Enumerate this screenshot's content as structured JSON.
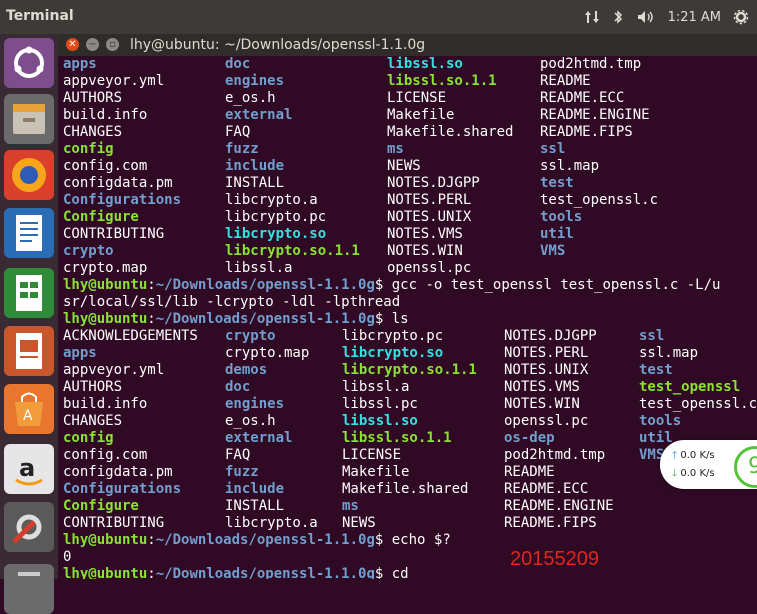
{
  "topbar": {
    "app_name": "Terminal",
    "time": "1:21 AM",
    "icons": [
      "network-updown-icon",
      "bluetooth-icon",
      "volume-icon",
      "settings-gear-icon"
    ]
  },
  "window": {
    "title": "lhy@ubuntu: ~/Downloads/openssl-1.1.0g"
  },
  "launcher": [
    "ubuntu-dash-icon",
    "files-icon",
    "firefox-icon",
    "libreoffice-writer-icon",
    "libreoffice-calc-icon",
    "libreoffice-impress-icon",
    "software-center-icon",
    "amazon-icon",
    "system-settings-icon",
    "trash-icon"
  ],
  "terminal": {
    "prompt_user": "lhy@ubuntu",
    "prompt_path": "~/Downloads/openssl-1.1.0g",
    "listing1": [
      [
        "apps",
        "doc",
        "libssl.so",
        "pod2htmd.tmp"
      ],
      [
        "appveyor.yml",
        "engines",
        "libssl.so.1.1",
        "README"
      ],
      [
        "AUTHORS",
        "e_os.h",
        "LICENSE",
        "README.ECC"
      ],
      [
        "build.info",
        "external",
        "Makefile",
        "README.ENGINE"
      ],
      [
        "CHANGES",
        "FAQ",
        "Makefile.shared",
        "README.FIPS"
      ],
      [
        "config",
        "fuzz",
        "ms",
        "ssl"
      ],
      [
        "config.com",
        "include",
        "NEWS",
        "ssl.map"
      ],
      [
        "configdata.pm",
        "INSTALL",
        "NOTES.DJGPP",
        "test"
      ],
      [
        "Configurations",
        "libcrypto.a",
        "NOTES.PERL",
        "test_openssl.c"
      ],
      [
        "Configure",
        "libcrypto.pc",
        "NOTES.UNIX",
        "tools"
      ],
      [
        "CONTRIBUTING",
        "libcrypto.so",
        "NOTES.VMS",
        "util"
      ],
      [
        "crypto",
        "libcrypto.so.1.1",
        "NOTES.WIN",
        "VMS"
      ],
      [
        "crypto.map",
        "libssl.a",
        "openssl.pc",
        ""
      ]
    ],
    "cmd_gcc": "$ gcc -o test_openssl test_openssl.c -L/u",
    "cmd_gcc_cont": "sr/local/ssl/lib -lcrypto -ldl -lpthread",
    "cmd_ls": "$ ls",
    "listing2": [
      [
        "ACKNOWLEDGEMENTS",
        "crypto",
        "libcrypto.pc",
        "NOTES.DJGPP",
        "ssl"
      ],
      [
        "apps",
        "crypto.map",
        "libcrypto.so",
        "NOTES.PERL",
        "ssl.map"
      ],
      [
        "appveyor.yml",
        "demos",
        "libcrypto.so.1.1",
        "NOTES.UNIX",
        "test"
      ],
      [
        "AUTHORS",
        "doc",
        "libssl.a",
        "NOTES.VMS",
        "test_openssl"
      ],
      [
        "build.info",
        "engines",
        "libssl.pc",
        "NOTES.WIN",
        "test_openssl.c"
      ],
      [
        "CHANGES",
        "e_os.h",
        "libssl.so",
        "openssl.pc",
        "tools"
      ],
      [
        "config",
        "external",
        "libssl.so.1.1",
        "os-dep",
        "util"
      ],
      [
        "config.com",
        "FAQ",
        "LICENSE",
        "pod2htmd.tmp",
        "VMS"
      ],
      [
        "configdata.pm",
        "fuzz",
        "Makefile",
        "README",
        ""
      ],
      [
        "Configurations",
        "include",
        "Makefile.shared",
        "README.ECC",
        ""
      ],
      [
        "Configure",
        "INSTALL",
        "ms",
        "README.ENGINE",
        ""
      ],
      [
        "CONTRIBUTING",
        "libcrypto.a",
        "NEWS",
        "README.FIPS",
        ""
      ]
    ],
    "cmd_echo": "$ echo $?",
    "echo_output": "0",
    "cmd_cd": "$ cd"
  },
  "net_widget": {
    "upload": "0.0 K/s",
    "download": "0.0 K/s",
    "percent": "9"
  },
  "stamp": "20155209",
  "colors": {
    "background": "#300a24",
    "dir": "#729fcf",
    "exec": "#8ae234",
    "link": "#34e2e2",
    "stamp": "#e0251b"
  }
}
